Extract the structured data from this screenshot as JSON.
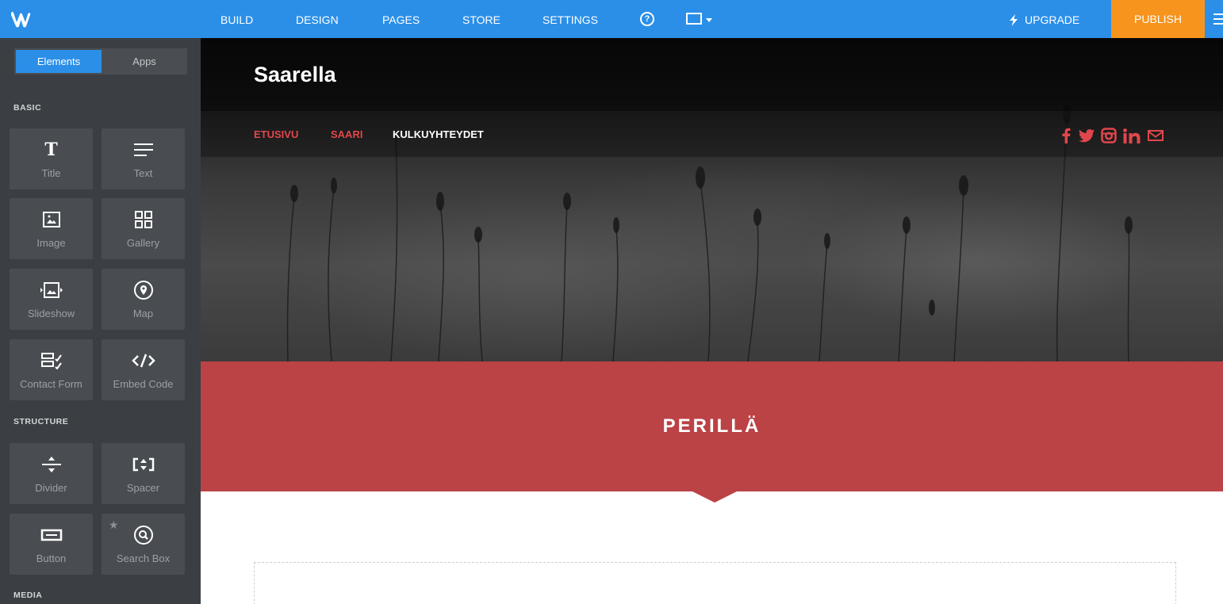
{
  "topbar": {
    "nav": [
      "BUILD",
      "DESIGN",
      "PAGES",
      "STORE",
      "SETTINGS"
    ],
    "help_glyph": "?",
    "upgrade_label": "UPGRADE",
    "publish_label": "PUBLISH",
    "colors": {
      "bar": "#2b8fe8",
      "publish": "#f7941d"
    }
  },
  "sidebar": {
    "tabs": {
      "active": "Elements",
      "inactive": "Apps"
    },
    "sections": {
      "basic": "BASIC",
      "structure": "STRUCTURE",
      "media": "MEDIA"
    },
    "basic_items": [
      {
        "label": "Title",
        "icon": "title-icon"
      },
      {
        "label": "Text",
        "icon": "text-lines-icon"
      },
      {
        "label": "Image",
        "icon": "image-icon"
      },
      {
        "label": "Gallery",
        "icon": "gallery-grid-icon"
      },
      {
        "label": "Slideshow",
        "icon": "slideshow-icon"
      },
      {
        "label": "Map",
        "icon": "map-pin-icon"
      },
      {
        "label": "Contact Form",
        "icon": "contact-form-icon"
      },
      {
        "label": "Embed Code",
        "icon": "embed-code-icon"
      }
    ],
    "structure_items": [
      {
        "label": "Divider",
        "icon": "divider-icon"
      },
      {
        "label": "Spacer",
        "icon": "spacer-icon"
      },
      {
        "label": "Button",
        "icon": "button-icon"
      },
      {
        "label": "Search Box",
        "icon": "search-icon"
      }
    ]
  },
  "site": {
    "title": "Saarella",
    "nav": [
      {
        "label": "ETUSIVU",
        "color": "#e0474c"
      },
      {
        "label": "SAARI",
        "color": "#e0474c"
      },
      {
        "label": "KULKUYHTEYDET",
        "color": "#ffffff"
      }
    ],
    "social_icons": [
      "facebook-icon",
      "twitter-icon",
      "instagram-icon",
      "linkedin-icon",
      "mail-icon"
    ],
    "social_color": "#e0474c",
    "banner_title": "PERILLÄ",
    "banner_color": "#bb4245"
  }
}
